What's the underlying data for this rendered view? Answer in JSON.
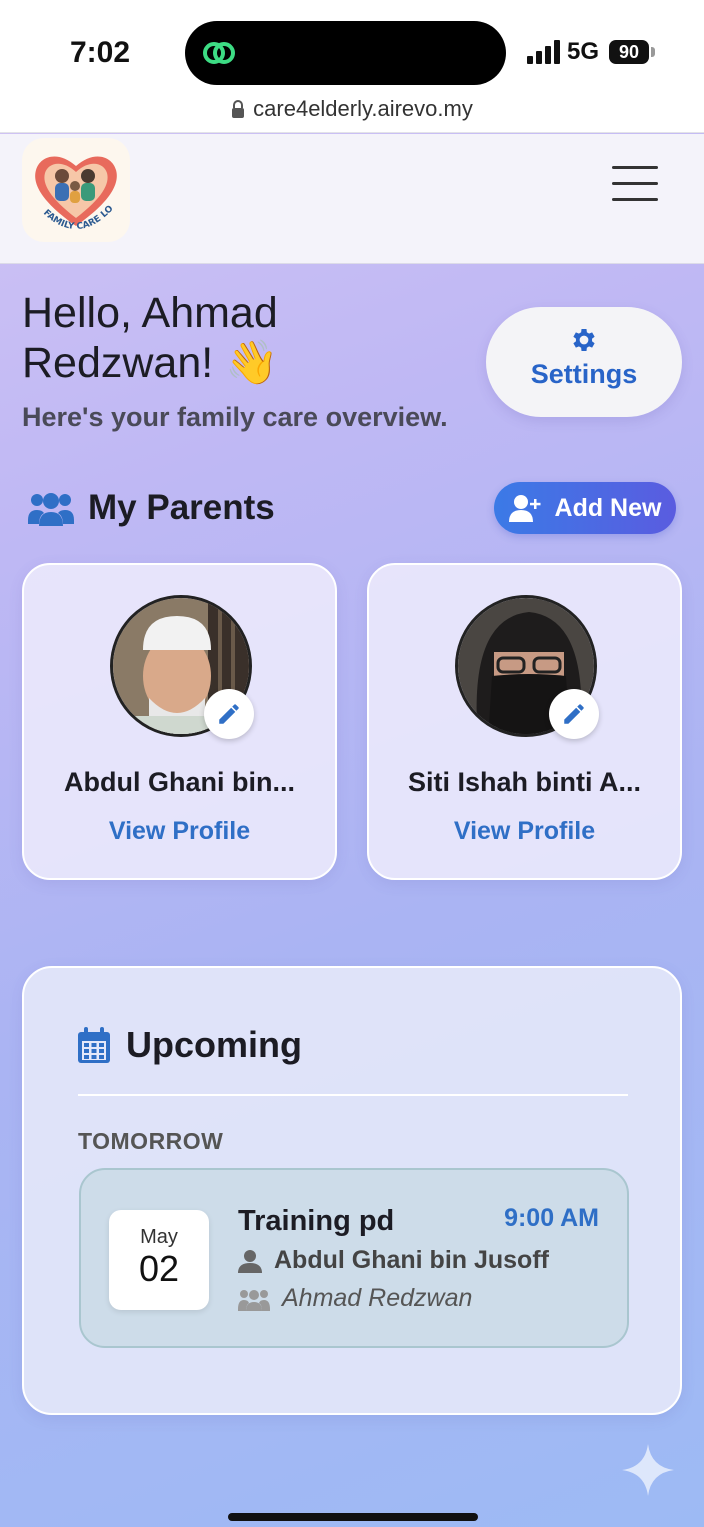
{
  "status_bar": {
    "time": "7:02",
    "network": "5G",
    "battery": "90"
  },
  "browser": {
    "url": "care4elderly.airevo.my"
  },
  "header": {
    "logo_text": "FAMILY CARE LOVE"
  },
  "greeting": {
    "line1": "Hello, Ahmad",
    "line2": "Redzwan! 👋",
    "subtitle": "Here's your family care overview."
  },
  "settings": {
    "label": "Settings"
  },
  "parents_section": {
    "title": "My Parents",
    "add_label": "Add New",
    "parents": [
      {
        "name": "Abdul Ghani bin...",
        "link": "View Profile"
      },
      {
        "name": "Siti Ishah binti A...",
        "link": "View Profile"
      }
    ]
  },
  "upcoming": {
    "title": "Upcoming",
    "day_label": "TOMORROW",
    "events": [
      {
        "month": "May",
        "day": "02",
        "title": "Training pd",
        "time": "9:00 AM",
        "person": "Abdul Ghani bin Jusoff",
        "family": "Ahmad Redzwan"
      }
    ]
  },
  "colors": {
    "accent": "#2f6fc6",
    "add_button_start": "#3b7ae6",
    "add_button_end": "#5a5ce0",
    "event_bg": "#cddce9"
  },
  "icons": [
    "lock-icon",
    "hamburger-icon",
    "gear-icon",
    "users-icon",
    "user-plus-icon",
    "pencil-icon",
    "calendar-icon",
    "user-icon",
    "family-icon",
    "sparkle-icon"
  ]
}
